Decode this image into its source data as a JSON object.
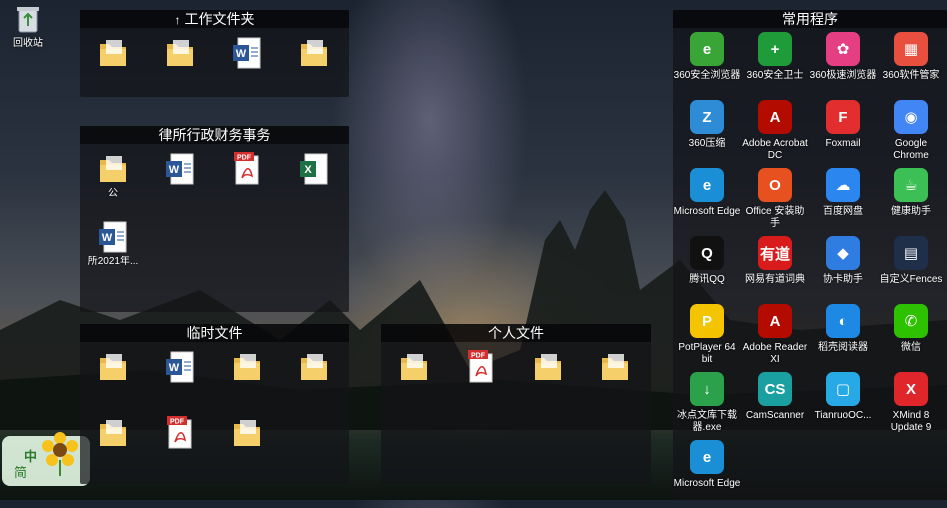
{
  "desktop": {
    "recycle_bin": "回收站",
    "widget": {
      "char1": "中",
      "char2": "简"
    }
  },
  "fences": {
    "work": {
      "title": "工作文件夹",
      "title_icon": "up-arrow-icon",
      "items": [
        {
          "icon": "folder-icon",
          "label": ""
        },
        {
          "icon": "folder-icon",
          "label": ""
        },
        {
          "icon": "word-icon",
          "label": ""
        },
        {
          "icon": "folder-icon",
          "label": ""
        }
      ]
    },
    "law": {
      "title": "律所行政财务事务",
      "items": [
        {
          "icon": "folder-icon",
          "label": "公"
        },
        {
          "icon": "word-icon",
          "label": ""
        },
        {
          "icon": "pdf-icon",
          "label": ""
        },
        {
          "icon": "excel-icon",
          "label": ""
        },
        {
          "icon": "word-icon",
          "label": "所2021年..."
        }
      ]
    },
    "temp": {
      "title": "临时文件",
      "items": [
        {
          "icon": "folder-icon",
          "label": ""
        },
        {
          "icon": "word-icon",
          "label": ""
        },
        {
          "icon": "folder-icon",
          "label": ""
        },
        {
          "icon": "folder-icon",
          "label": ""
        },
        {
          "icon": "folder-icon",
          "label": ""
        },
        {
          "icon": "pdf-icon",
          "label": ""
        },
        {
          "icon": "folder-icon",
          "label": ""
        }
      ]
    },
    "personal": {
      "title": "个人文件",
      "items": [
        {
          "icon": "folder-icon",
          "label": ""
        },
        {
          "icon": "pdf-icon",
          "label": ""
        },
        {
          "icon": "folder-icon",
          "label": ""
        },
        {
          "icon": "folder-icon",
          "label": ""
        }
      ]
    }
  },
  "programs": {
    "title": "常用程序",
    "apps": [
      {
        "label": "360安全浏览器",
        "icon": "360-browser-icon",
        "color": "#3aa537"
      },
      {
        "label": "360安全卫士",
        "icon": "360-guard-icon",
        "color": "#1f9b3a"
      },
      {
        "label": "360极速浏览器",
        "icon": "360-speed-browser-icon",
        "color": "#e53e82"
      },
      {
        "label": "360软件管家",
        "icon": "360-software-manager-icon",
        "color": "#e94f3f"
      },
      {
        "label": "360压缩",
        "icon": "360-zip-icon",
        "color": "#2e8bd6"
      },
      {
        "label": "Adobe Acrobat DC",
        "icon": "acrobat-icon",
        "color": "#b30b00"
      },
      {
        "label": "Foxmail",
        "icon": "foxmail-icon",
        "color": "#e22e2e"
      },
      {
        "label": "Google Chrome",
        "icon": "chrome-icon",
        "color": "#4285f4"
      },
      {
        "label": "Microsoft Edge",
        "icon": "edge-icon",
        "color": "#1b8fd6"
      },
      {
        "label": "Office 安装助手",
        "icon": "office-icon",
        "color": "#e6511f"
      },
      {
        "label": "百度网盘",
        "icon": "baidu-netdisk-icon",
        "color": "#2b86f0"
      },
      {
        "label": "健康助手",
        "icon": "health-assistant-icon",
        "color": "#3cbf55"
      },
      {
        "label": "腾讯QQ",
        "icon": "qq-icon",
        "color": "#111111"
      },
      {
        "label": "网易有道词典",
        "icon": "youdao-icon",
        "color": "#d91b1b"
      },
      {
        "label": "协卡助手",
        "icon": "xieka-icon",
        "color": "#2f7de1"
      },
      {
        "label": "自定义Fences",
        "icon": "fences-icon",
        "color": "#1f2f4a"
      },
      {
        "label": "PotPlayer 64 bit",
        "icon": "potplayer-icon",
        "color": "#f5c400"
      },
      {
        "label": "Adobe Reader XI",
        "icon": "adobe-reader-icon",
        "color": "#b30b00"
      },
      {
        "label": "稻壳阅读器",
        "icon": "docer-reader-icon",
        "color": "#1e88e5"
      },
      {
        "label": "微信",
        "icon": "wechat-icon",
        "color": "#2dc100"
      },
      {
        "label": "冰点文库下载器.exe",
        "icon": "bingdian-icon",
        "color": "#2aa14a"
      },
      {
        "label": "CamScanner",
        "icon": "camscanner-icon",
        "color": "#1aa0a0"
      },
      {
        "label": "TianruoOC...",
        "icon": "tianruo-ocr-icon",
        "color": "#27a9e6"
      },
      {
        "label": "XMind 8 Update 9",
        "icon": "xmind-icon",
        "color": "#e0262b"
      },
      {
        "label": "Microsoft Edge",
        "icon": "edge-icon",
        "color": "#1b8fd6"
      }
    ]
  }
}
